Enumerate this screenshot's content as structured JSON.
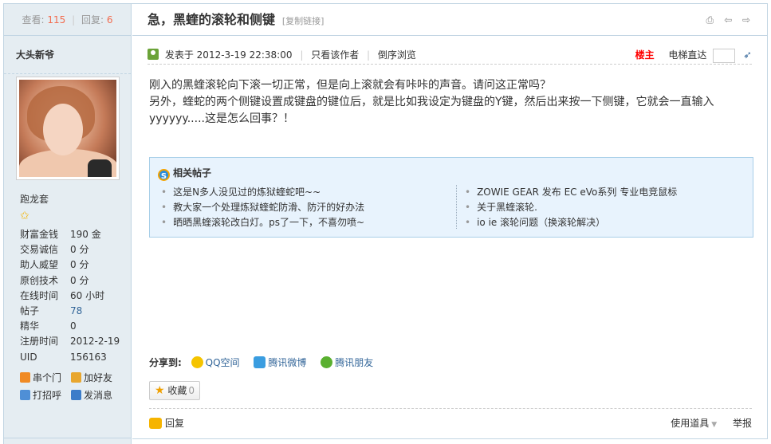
{
  "thread": {
    "views_label": "查看:",
    "views": "115",
    "replies_label": "回复:",
    "replies": "6",
    "separator": "|",
    "title": "急，黑蝰的滚轮和侧键",
    "copy_link": "[复制链接]"
  },
  "author": {
    "name": "大头新爷",
    "rank": "跑龙套",
    "stats": [
      {
        "label": "财富金钱",
        "value": "190 金"
      },
      {
        "label": "交易诚信",
        "value": "0 分"
      },
      {
        "label": "助人威望",
        "value": "0 分"
      },
      {
        "label": "原创技术",
        "value": "0 分"
      },
      {
        "label": "在线时间",
        "value": "60 小时"
      },
      {
        "label": "帖子",
        "value": "78"
      },
      {
        "label": "精华",
        "value": "0"
      },
      {
        "label": "注册时间",
        "value": "2012-2-19"
      },
      {
        "label": "UID",
        "value": "156163"
      }
    ],
    "actions": {
      "visit": "串个门",
      "add_friend": "加好友",
      "greet": "打招呼",
      "message": "发消息"
    }
  },
  "post": {
    "posted_prefix": "发表于",
    "posted_time": "2012-3-19 22:38:00",
    "only_author": "只看该作者",
    "reverse": "倒序浏览",
    "owner_label": "楼主",
    "jump_label": "电梯直达",
    "body_line1": "刚入的黑蝰滚轮向下滚一切正常，但是向上滚就会有咔咔的声音。请问这正常吗？",
    "body_line2": "另外，蝰蛇的两个侧键设置成键盘的键位后，就是比如我设定为键盘的Y键，然后出来按一下侧键，它就会一直输入",
    "body_line3": "yyyyyy.....这是怎么回事？！"
  },
  "related": {
    "heading": "相关帖子",
    "left": [
      "这是N多人没见过的炼狱蝰蛇吧~~",
      "教大家一个处理炼狱蝰蛇防滑、防汗的好办法",
      "晒晒黑蝰滚轮改白灯。ps了一下，不喜勿喷~"
    ],
    "right": [
      "ZOWIE GEAR 发布 EC eVo系列 专业电竞鼠标",
      "关于黑蝰滚轮.",
      "io ie 滚轮问题（换滚轮解决）"
    ]
  },
  "share": {
    "label": "分享到:",
    "qzone": "QQ空间",
    "weibo": "腾讯微博",
    "pengyou": "腾讯朋友"
  },
  "favorite": {
    "label": "收藏",
    "count": "0"
  },
  "footer": {
    "reply": "回复",
    "tools": "使用道具",
    "report": "举报"
  }
}
